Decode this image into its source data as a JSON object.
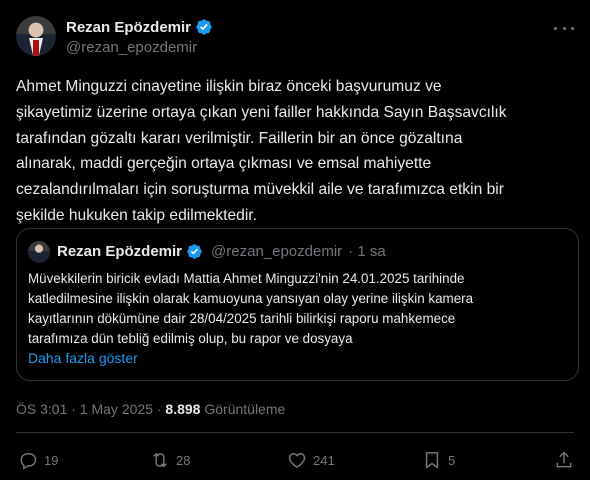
{
  "tweet": {
    "author_name": "Rezan Epözdemir",
    "author_handle": "@rezan_epozdemir",
    "text": "Ahmet Minguzzi cinayetine ilişkin biraz önceki başvurumuz ve\nşikayetimiz üzerine ortaya çıkan yeni failler hakkında Sayın Başsavcılık\ntarafından gözaltı kararı verilmiştir. Faillerin bir an önce gözaltına\nalınarak, maddi gerçeğin ortaya çıkması ve emsal mahiyette\ncezalandırılmaları için soruşturma müvekkil aile ve tarafımızca etkin bir\nşekilde hukuken takip edilmektedir.",
    "time": "ÖS 3:01 · 1 May 2025 ·",
    "views_count": "8.898",
    "views_label": "Görüntüleme"
  },
  "quote": {
    "author_name": "Rezan Epözdemir",
    "author_handle": "@rezan_epozdemir",
    "time": "· 1 sa",
    "text": "Müvekkilerin biricik evladı Mattia Ahmet Minguzzi'nin 24.01.2025 tarihinde\nkatledilmesine ilişkin olarak kamuoyuna yansıyan olay yerine ilişkin kamera\nkayıtlarının dökümüne dair 28/04/2025 tarihli bilirkişi raporu mahkemece\ntarafımıza dün tebliğ edilmiş olup, bu rapor ve dosyaya",
    "show_more": "Daha fazla göster"
  },
  "actions": {
    "replies": "19",
    "reposts": "28",
    "likes": "241",
    "bookmarks": "5"
  },
  "colors": {
    "background": "#000000",
    "text": "#e7e9ea",
    "muted": "#71767b",
    "link": "#1d9bf0",
    "verified": "#1d9bf0",
    "border": "#2f3336"
  }
}
